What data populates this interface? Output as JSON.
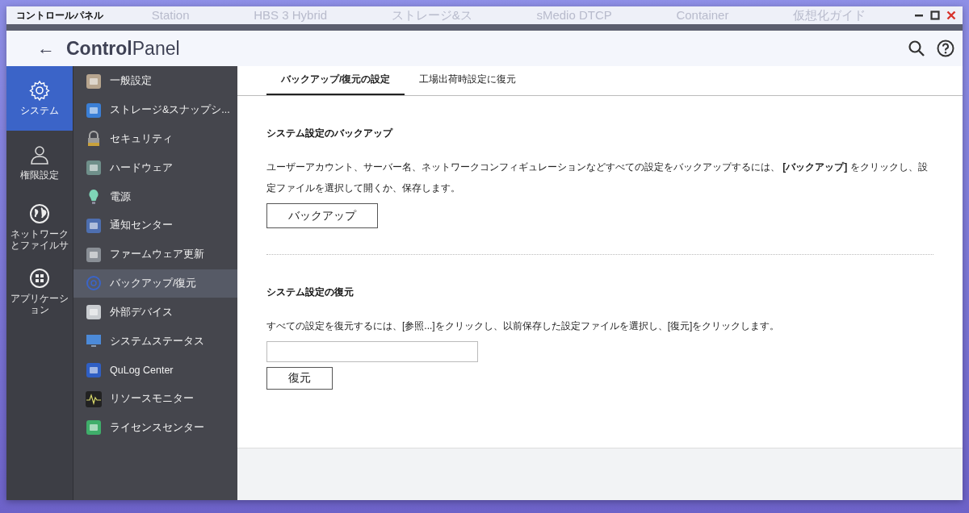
{
  "window": {
    "title": "コントロールパネル"
  },
  "background_apps": [
    "Station",
    "HBS 3 Hybrid",
    "ストレージ&ス",
    "sMedio DTCP",
    "Container",
    "仮想化ガイド"
  ],
  "header": {
    "back": "←",
    "title_bold": "Control",
    "title_rest": "Panel"
  },
  "nav": [
    {
      "label": "システム",
      "selected": true
    },
    {
      "label": "権限設定",
      "selected": false
    },
    {
      "label": "ネットワークとファイルサ",
      "selected": false
    },
    {
      "label": "アプリケーション",
      "selected": false
    }
  ],
  "submenu": [
    {
      "label": "一般設定",
      "selected": false
    },
    {
      "label": "ストレージ&スナップシ...",
      "selected": false
    },
    {
      "label": "セキュリティ",
      "selected": false
    },
    {
      "label": "ハードウェア",
      "selected": false
    },
    {
      "label": "電源",
      "selected": false
    },
    {
      "label": "通知センター",
      "selected": false
    },
    {
      "label": "ファームウェア更新",
      "selected": false
    },
    {
      "label": "バックアップ/復元",
      "selected": true
    },
    {
      "label": "外部デバイス",
      "selected": false
    },
    {
      "label": "システムステータス",
      "selected": false
    },
    {
      "label": "QuLog Center",
      "selected": false
    },
    {
      "label": "リソースモニター",
      "selected": false
    },
    {
      "label": "ライセンスセンター",
      "selected": false
    }
  ],
  "tabs": [
    {
      "label": "バックアップ/復元の設定",
      "selected": true
    },
    {
      "label": "工場出荷時設定に復元",
      "selected": false
    }
  ],
  "backup": {
    "heading": "システム設定のバックアップ",
    "text": "ユーザーアカウント、サーバー名、ネットワークコンフィギュレーションなどすべての設定をバックアップするには、 **[バックアップ]** をクリックし、設定ファイルを選択して開くか、保存します。",
    "button": "バックアップ"
  },
  "restore": {
    "heading": "システム設定の復元",
    "text": "すべての設定を復元するには、[参照...]をクリックし、以前保存した設定ファイルを選択し、[復元]をクリックします。",
    "button": "復元"
  }
}
